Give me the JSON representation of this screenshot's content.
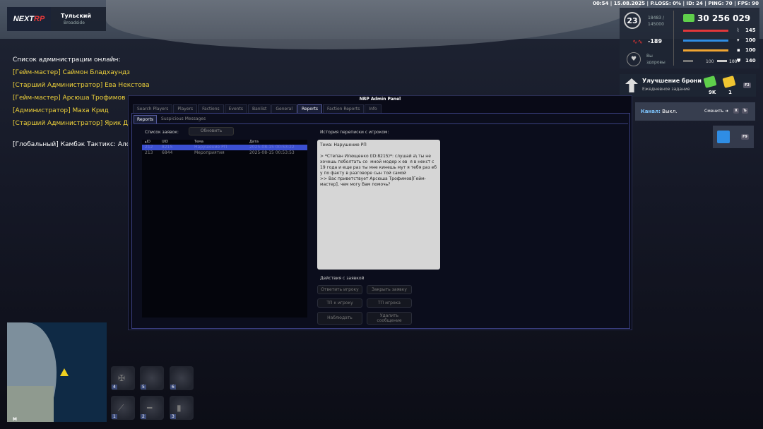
{
  "topbar": "00:54 | 15.08.2025 | P.LOSS: 0% | ID: 24 | PING: 70 | FPS: 90",
  "logo": {
    "brand_a": "NEXT",
    "brand_b": "RP",
    "city": "Тульский",
    "district": "Broadside"
  },
  "admins": {
    "header": "Список администрации онлайн:",
    "items": [
      "[Гейм-мастер] Саймон Бладхаундз",
      "[Старший Администратор] Ева Некстова",
      "[Гейм-мастер] Арсюша Трофимов",
      "[Администратор] Маха Крид",
      "[Старший Администратор] Ярик Ди"
    ],
    "global": "[Глобальный] Камбэк Тактикс: Ало са"
  },
  "hud": {
    "level": "23",
    "exp": "18483 /",
    "exp_total": "145000",
    "money": "30 256 029",
    "rep": "-189",
    "health_1": "Вы",
    "health_2": "здоровы",
    "bars": [
      {
        "value": "145",
        "color": "#e2373a",
        "icon": "pulse-icon"
      },
      {
        "value": "100",
        "color": "#2f8de4",
        "icon": "drink-icon"
      },
      {
        "value": "100",
        "color": "#f0a532",
        "icon": "food-icon"
      }
    ],
    "extra_a": "100",
    "extra_b": "100",
    "extra_c": "140"
  },
  "armor": {
    "title": "Улучшение брони",
    "subtitle": "Ежедневное задание",
    "reward_money": "9K",
    "reward_coin": "1",
    "key": "F2"
  },
  "channel": {
    "label": "Канал:",
    "value": "Выкл.",
    "change": "Сменить ➜",
    "key1": "X",
    "key2": "Ъ"
  },
  "calendar": {
    "key": "F9"
  },
  "panel": {
    "title": "NRP Admin Panel",
    "tabs": [
      "Search Players",
      "Players",
      "Factions",
      "Events",
      "Banlist",
      "General",
      "Reports",
      "Faction Reports",
      "Info"
    ],
    "active_tab": "Reports",
    "subtabs": [
      "Reports",
      "Suspicious Messages"
    ],
    "list_label": "Список заявок:",
    "refresh": "Обновить",
    "columns": [
      "ID",
      "UID",
      "Тема",
      "Дата"
    ],
    "rows": [
      {
        "id": "212",
        "uid": "8215",
        "topic": "Нарушение РП",
        "date": "2025-08-15 00:53:22",
        "selected": true
      },
      {
        "id": "213",
        "uid": "6844",
        "topic": "Мероприятия",
        "date": "2025-08-15 00:53:53",
        "selected": false
      }
    ],
    "history_label": "История переписки с игроком:",
    "history_text": "Тема: Нарушение РП\n\n> *Степан Илющенко (ID:8215)*: слушай а\\ ты не хочешь поболтать со  мной модер х ев  я в некст с 19 года и еще раз ты мне кинешь мут я тебя раз еб у по факту в разговоре сын той самой\n>> Вас приветствует Арсюша Трофимов[Гейм-мастер], чем могу Вам помочь?",
    "actions_label": "Действия с заявкой",
    "btn_answer": "Ответить игроку",
    "btn_close": "Закрыть заявку",
    "btn_tp_to": "ТП к игроку",
    "btn_tp_player": "ТП игрока",
    "btn_watch": "Наблюдать",
    "btn_delete": "Удалить сообщение"
  },
  "minimap": {
    "label": "M"
  },
  "slots": [
    "4",
    "5",
    "6",
    "1",
    "2",
    "3"
  ]
}
